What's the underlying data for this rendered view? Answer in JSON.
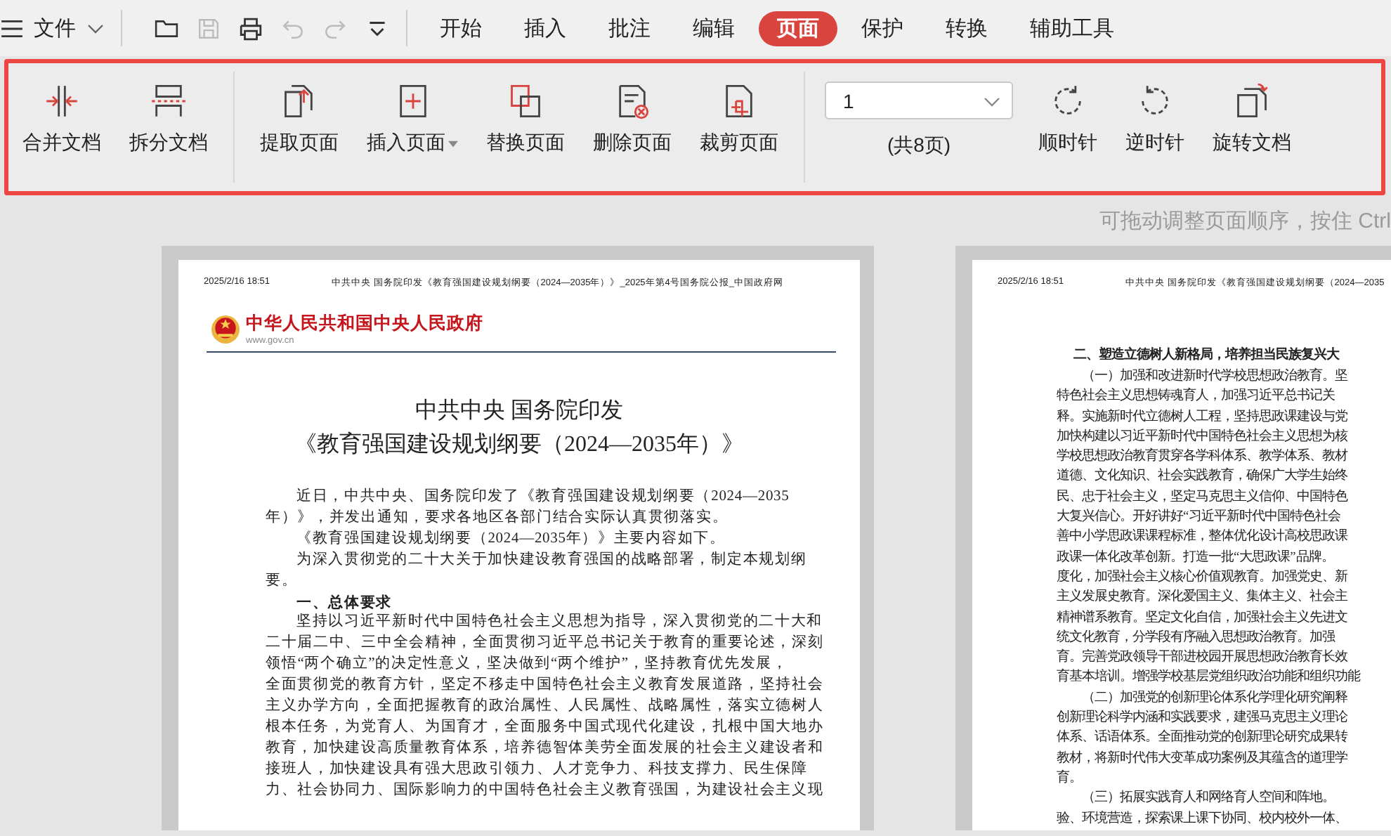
{
  "menu": {
    "file_label": "文件",
    "tabs": [
      {
        "label": "开始",
        "selected": false
      },
      {
        "label": "插入",
        "selected": false
      },
      {
        "label": "批注",
        "selected": false
      },
      {
        "label": "编辑",
        "selected": false
      },
      {
        "label": "页面",
        "selected": true
      },
      {
        "label": "保护",
        "selected": false
      },
      {
        "label": "转换",
        "selected": false
      },
      {
        "label": "辅助工具",
        "selected": false
      }
    ]
  },
  "ribbon": {
    "groups": [
      {
        "items": [
          {
            "label": "合并文档",
            "kind": "merge"
          },
          {
            "label": "拆分文档",
            "kind": "split"
          }
        ]
      },
      {
        "items": [
          {
            "label": "提取页面",
            "kind": "extract"
          },
          {
            "label": "插入页面",
            "kind": "insert",
            "dropdown": true
          },
          {
            "label": "替换页面",
            "kind": "replace"
          },
          {
            "label": "删除页面",
            "kind": "delete"
          },
          {
            "label": "裁剪页面",
            "kind": "crop"
          }
        ]
      }
    ],
    "page_select": {
      "value": "1",
      "total": "(共8页)"
    },
    "rotate": [
      {
        "label": "顺时针",
        "kind": "cw"
      },
      {
        "label": "逆时针",
        "kind": "ccw"
      },
      {
        "label": "旋转文档",
        "kind": "rotate-doc"
      }
    ]
  },
  "hint": "可拖动调整页面顺序，按住 Ctrl",
  "pages": [
    {
      "header_time": "2025/2/16 18:51",
      "header_title": "中共中央 国务院印发《教育强国建设规划纲要（2024—2035年）》_2025年第4号国务院公报_中国政府网",
      "blocks": [
        {
          "kind": "logo",
          "title": "中华人民共和国中央人民政府",
          "url": "www.gov.cn"
        },
        {
          "kind": "title",
          "text": "中共中央 国务院印发"
        },
        {
          "kind": "title",
          "text": "《教育强国建设规划纲要（2024—2035年）》"
        },
        {
          "kind": "line",
          "indent": true,
          "text": "近日，中共中央、国务院印发了《教育强国建设规划纲要（2024—2035"
        },
        {
          "kind": "line",
          "indent": false,
          "text": "年）》，并发出通知，要求各地区各部门结合实际认真贯彻落实。"
        },
        {
          "kind": "line",
          "indent": true,
          "text": "《教育强国建设规划纲要（2024—2035年）》主要内容如下。"
        },
        {
          "kind": "line",
          "indent": true,
          "text": "为深入贯彻党的二十大关于加快建设教育强国的战略部署，制定本规划纲"
        },
        {
          "kind": "line",
          "indent": false,
          "text": "要。"
        },
        {
          "kind": "heading",
          "indent": true,
          "text": "一、总体要求"
        },
        {
          "kind": "line",
          "indent": true,
          "text": "坚持以习近平新时代中国特色社会主义思想为指导，深入贯彻党的二十大和"
        },
        {
          "kind": "line",
          "indent": false,
          "text": "二十届二中、三中全会精神，全面贯彻习近平总书记关于教育的重要论述，深刻"
        },
        {
          "kind": "line",
          "indent": false,
          "text": "领悟“两个确立”的决定性意义，坚决做到“两个维护”，坚持教育优先发展，"
        },
        {
          "kind": "line",
          "indent": false,
          "text": "全面贯彻党的教育方针，坚定不移走中国特色社会主义教育发展道路，坚持社会"
        },
        {
          "kind": "line",
          "indent": false,
          "text": "主义办学方向，全面把握教育的政治属性、人民属性、战略属性，落实立德树人"
        },
        {
          "kind": "line",
          "indent": false,
          "text": "根本任务，为党育人、为国育才，全面服务中国式现代化建设，扎根中国大地办"
        },
        {
          "kind": "line",
          "indent": false,
          "text": "教育，加快建设高质量教育体系，培养德智体美劳全面发展的社会主义建设者和"
        },
        {
          "kind": "line",
          "indent": false,
          "text": "接班人，加快建设具有强大思政引领力、人才竞争力、科技支撑力、民生保障"
        },
        {
          "kind": "line",
          "indent": false,
          "text": "力、社会协同力、国际影响力的中国特色社会主义教育强国，为建设社会主义现"
        }
      ]
    },
    {
      "header_time": "2025/2/16 18:51",
      "header_title": "中共中央 国务院印发《教育强国建设规划纲要（2024—2035",
      "blocks": [
        {
          "kind": "heading",
          "indent": true,
          "text": "二、塑造立德树人新格局，培养担当民族复兴大"
        },
        {
          "kind": "line",
          "indent": true,
          "text": "（一）加强和改进新时代学校思想政治教育。坚"
        },
        {
          "kind": "line",
          "indent": false,
          "text": "特色社会主义思想铸魂育人，加强习近平总书记关"
        },
        {
          "kind": "line",
          "indent": false,
          "text": "释。实施新时代立德树人工程，坚持思政课建设与党"
        },
        {
          "kind": "line",
          "indent": false,
          "text": "加快构建以习近平新时代中国特色社会主义思想为核"
        },
        {
          "kind": "line",
          "indent": false,
          "text": "学校思想政治教育贯穿各学科体系、教学体系、教材"
        },
        {
          "kind": "line",
          "indent": false,
          "text": "道德、文化知识、社会实践教育，确保广大学生始终"
        },
        {
          "kind": "line",
          "indent": false,
          "text": "民、忠于社会主义，坚定马克思主义信仰、中国特色"
        },
        {
          "kind": "line",
          "indent": false,
          "text": "大复兴信心。开好讲好“习近平新时代中国特色社会"
        },
        {
          "kind": "line",
          "indent": false,
          "text": "善中小学思政课课程标准，整体优化设计高校思政课"
        },
        {
          "kind": "line",
          "indent": false,
          "text": "政课一体化改革创新。打造一批“大思政课”品牌。"
        },
        {
          "kind": "line",
          "indent": false,
          "text": "度化，加强社会主义核心价值观教育。加强党史、新"
        },
        {
          "kind": "line",
          "indent": false,
          "text": "主义发展史教育。深化爱国主义、集体主义、社会主"
        },
        {
          "kind": "line",
          "indent": false,
          "text": "精神谱系教育。坚定文化自信，加强社会主义先进文"
        },
        {
          "kind": "line",
          "indent": false,
          "text": "统文化教育，分学段有序融入思想政治教育。加强"
        },
        {
          "kind": "line",
          "indent": false,
          "text": "育。完善党政领导干部进校园开展思想政治教育长效"
        },
        {
          "kind": "line",
          "indent": false,
          "text": "育基本培训。增强学校基层党组织政治功能和组织功能"
        },
        {
          "kind": "line",
          "indent": true,
          "text": "（二）加强党的创新理论体系化学理化研究阐释"
        },
        {
          "kind": "line",
          "indent": false,
          "text": "创新理论科学内涵和实践要求，建强马克思主义理论"
        },
        {
          "kind": "line",
          "indent": false,
          "text": "体系、话语体系。全面推动党的创新理论研究成果转"
        },
        {
          "kind": "line",
          "indent": false,
          "text": "教材，将新时代伟大变革成功案例及其蕴含的道理学"
        },
        {
          "kind": "line",
          "indent": false,
          "text": "育。"
        },
        {
          "kind": "line",
          "indent": true,
          "text": "（三）拓展实践育人和网络育人空间和阵地。"
        },
        {
          "kind": "line",
          "indent": false,
          "text": "验、环境营造，探索课上课下协同、校内校外一体、"
        }
      ]
    }
  ]
}
